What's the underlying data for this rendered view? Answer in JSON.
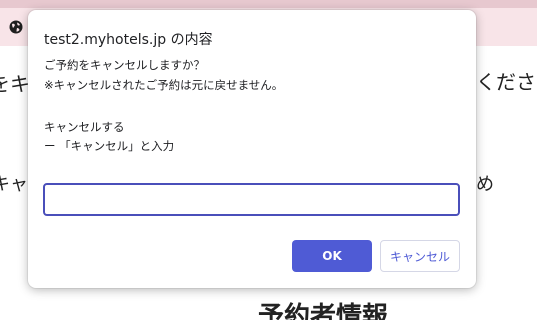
{
  "background": {
    "left_text_1": "をキャ",
    "right_text_1": "くださ",
    "left_text_2": "キャ",
    "right_text_2": "め",
    "heading": "予約者情報"
  },
  "dialog": {
    "title": "test2.myhotels.jp の内容",
    "message_lines": [
      "ご予約をキャンセルしますか？",
      "※キャンセルされたご予約は元に戻せません。",
      "キャンセルする",
      "ー 「キャンセル」と入力"
    ],
    "input": {
      "value": "",
      "placeholder": ""
    },
    "ok_label": "OK",
    "cancel_label": "キャンセル"
  },
  "colors": {
    "accent": "#4f5bd5",
    "notice_bar": "#f8e4e8",
    "input_border": "#4a4fba"
  },
  "icons": {
    "notice": "globe-icon"
  }
}
